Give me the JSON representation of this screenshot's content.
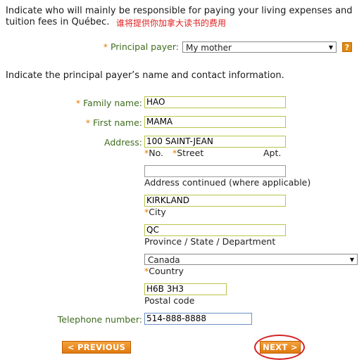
{
  "intro_text": "Indicate who will mainly be responsible for paying your living expenses and tuition fees in Québec.",
  "annotation_zh": "谁将提供你加拿大读书的费用",
  "principal_payer": {
    "label": "Principal payer:",
    "value": "My mother",
    "help": "?"
  },
  "section_text": "Indicate the principal payer’s name and contact information.",
  "fields": {
    "family_name": {
      "label": "Family name:",
      "value": "HAO"
    },
    "first_name": {
      "label": "First name:",
      "value": "MAMA"
    },
    "address": {
      "label": "Address:",
      "value": "100 SAINT-JEAN",
      "sub_no": "No.",
      "sub_street": "Street",
      "sub_apt": "Apt."
    },
    "address2": {
      "value": "",
      "sublabel": "Address continued (where applicable)"
    },
    "city": {
      "value": "KIRKLAND",
      "sublabel": "City"
    },
    "province": {
      "value": "QC",
      "sublabel": "Province / State / Department"
    },
    "country": {
      "value": "Canada",
      "sublabel": "Country"
    },
    "postal": {
      "value": "H6B 3H3",
      "sublabel": "Postal code"
    },
    "telephone": {
      "label": "Telephone number:",
      "value": "514-888-8888"
    }
  },
  "required_mark": "*",
  "buttons": {
    "previous": "< PREVIOUS",
    "next": "NEXT >"
  },
  "colors": {
    "label_green": "#3f6b1f",
    "required_orange": "#e07a00",
    "button_orange": "#e07a10",
    "annotation_red": "#e02020",
    "field_border": "#b9c54a"
  }
}
